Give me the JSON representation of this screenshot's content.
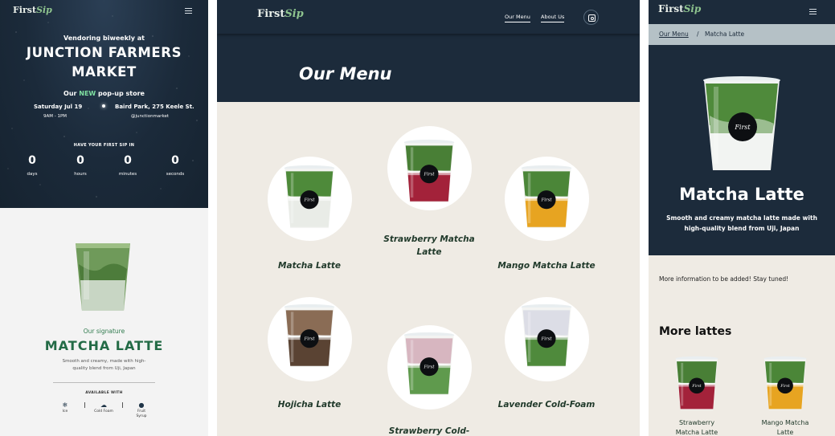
{
  "brand": {
    "logo_first": "First",
    "logo_sip": "Sip"
  },
  "home": {
    "vendoring": "Vendoring biweekly at",
    "market_line1": "JUNCTION FARMERS",
    "market_line2": "MARKET",
    "popup_pre": "Our ",
    "popup_new": "NEW",
    "popup_post": " pop-up store",
    "date": "Saturday Jul 19",
    "time": "9AM - 1PM",
    "place": "Baird Park, 275 Keele St.",
    "handle": "@junctionmarket",
    "countdown_heading": "HAVE YOUR FIRST SIP IN",
    "countdown": [
      {
        "value": "0",
        "label": "days"
      },
      {
        "value": "0",
        "label": "hours"
      },
      {
        "value": "0",
        "label": "minutes"
      },
      {
        "value": "0",
        "label": "seconds"
      }
    ],
    "signature_sub": "Our signature",
    "signature_title": "MATCHA LATTE",
    "signature_desc": "Smooth and creamy, made with high-quality blend from Uji, Japan",
    "available_with": "AVAILABLE WITH",
    "options": [
      {
        "icon": "snowflake-icon",
        "glyph": "❄",
        "label": "Ice"
      },
      {
        "icon": "cloud-icon",
        "glyph": "☁",
        "label": "Cold Foam"
      },
      {
        "icon": "drop-icon",
        "glyph": "💧",
        "label": "Fruit Syrup"
      }
    ]
  },
  "menu_page": {
    "nav": {
      "menu": "Our Menu",
      "about": "About Us"
    },
    "title": "Our Menu",
    "items": [
      {
        "name": "Matcha Latte",
        "top": "#4e8a3a",
        "bottom": "#e9ece7"
      },
      {
        "name": "Strawberry Matcha Latte",
        "top": "#497f36",
        "bottom": "#a3223a"
      },
      {
        "name": "Mango Matcha Latte",
        "top": "#4b8638",
        "bottom": "#e7a421"
      },
      {
        "name": "Hojicha Latte",
        "top": "#8a6c55",
        "bottom": "#5a4333"
      },
      {
        "name": "Strawberry Cold-",
        "top": "#d7b6c0",
        "bottom": "#5f9a4d"
      },
      {
        "name": "Lavender Cold-Foam",
        "top": "#dcdde6",
        "bottom": "#4f8a3c"
      }
    ]
  },
  "detail": {
    "breadcrumb_link": "Our Menu",
    "breadcrumb_sep": "/",
    "breadcrumb_current": "Matcha Latte",
    "title": "Matcha Latte",
    "desc": "Smooth and creamy matcha latte made with high-quality blend from Uji, Japan",
    "more_info": "More information to be added! Stay tuned!",
    "more_heading": "More lattes",
    "more_items": [
      {
        "name": "Strawberry Matcha Latte",
        "top": "#497f36",
        "bottom": "#a3223a"
      },
      {
        "name": "Mango Matcha Latte",
        "top": "#4b8638",
        "bottom": "#e7a421"
      }
    ]
  }
}
